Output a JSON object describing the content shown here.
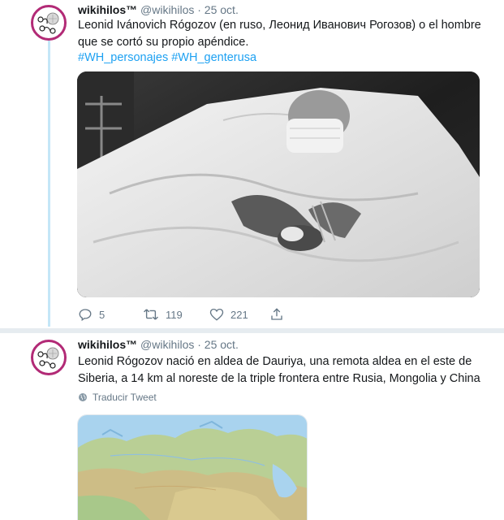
{
  "tweets": [
    {
      "author_name": "wikihilos™",
      "handle": "@wikihilos",
      "date": "· 25 oct.",
      "text_line1": "Leonid Ivánovich Rógozov (en ruso, Леонид Иванович Рогозов) o el hombre",
      "text_line2": "que se cortó su propio apéndice.",
      "hashtags": [
        "#WH_personajes",
        "#WH_genterusa"
      ],
      "replies": "5",
      "retweets": "119",
      "likes": "221"
    },
    {
      "author_name": "wikihilos™",
      "handle": "@wikihilos",
      "date": "· 25 oct.",
      "text_line1": "Leonid Rógozov nació en aldea de Dauriya, una remota aldea en el este de",
      "text_line2": "Siberia, a 14 km al noreste de la triple frontera entre Rusia, Mongolia y China",
      "translate_label": "Traducir Tweet"
    }
  ],
  "icons": {
    "reply": "reply-icon",
    "retweet": "retweet-icon",
    "like": "heart-icon",
    "share": "share-icon",
    "globe": "globe-icon"
  },
  "colors": {
    "link": "#1da1f2",
    "muted": "#657786",
    "avatar_border": "#b22a76",
    "thread_line": "#c4e6f7",
    "separator": "#e6ecf0"
  }
}
